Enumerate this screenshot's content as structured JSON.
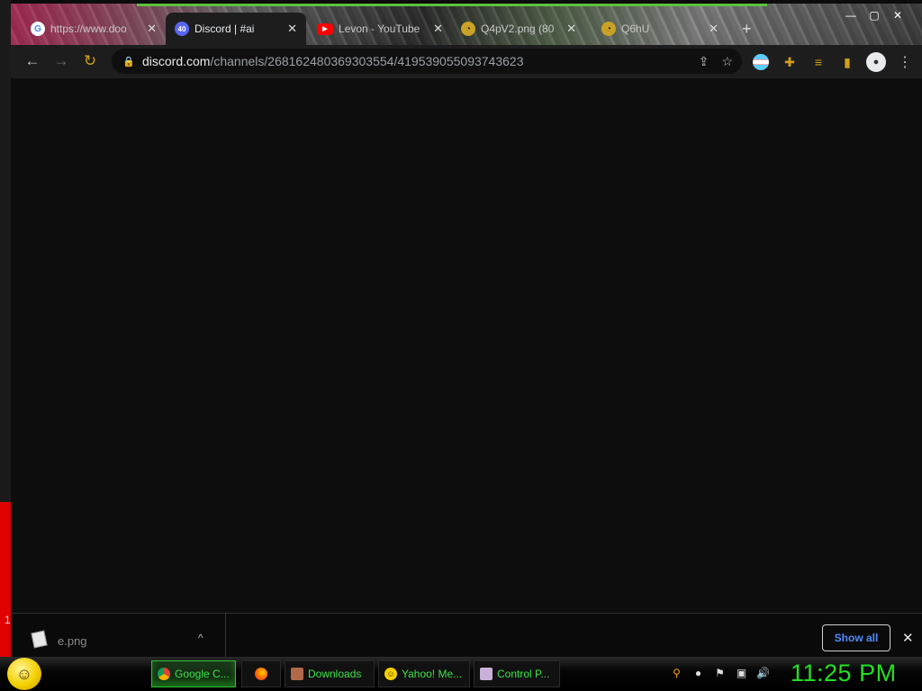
{
  "desktop": {
    "left_marker": "1"
  },
  "tabs": [
    {
      "title": "https://www.doo",
      "favicon": "google-icon",
      "fav_text": "G",
      "close": "✕"
    },
    {
      "title": "Discord | #ai",
      "favicon": "discord-icon",
      "fav_text": "40",
      "close": "✕"
    },
    {
      "title": "Levon - YouTube",
      "favicon": "youtube-icon",
      "fav_text": "▶",
      "close": "✕"
    },
    {
      "title": "Q4pV2.png (80",
      "favicon": "image-icon",
      "fav_text": "◔",
      "close": "✕"
    },
    {
      "title": "Q6hU",
      "favicon": "image-icon",
      "fav_text": "◔",
      "close": "✕"
    }
  ],
  "new_tab": "+",
  "window_controls": {
    "minimize": "—",
    "maximize": "▢",
    "close": "✕"
  },
  "toolbar": {
    "back": "←",
    "forward": "→",
    "reload": "↻",
    "lock": "🔒",
    "url_host": "discord.com",
    "url_path": "/channels/268162480369303554/419539055093743623",
    "share": "⇪",
    "star": "☆",
    "puzzle": "✚",
    "media": "≡",
    "sidepanel": "▮",
    "profile": "●",
    "menu": "⋮"
  },
  "download_shelf": {
    "file_name": "e.png",
    "caret": "^",
    "show_all": "Show all",
    "close": "✕"
  },
  "taskbar": {
    "start": "☺",
    "buttons": [
      {
        "label": "Google C...",
        "icon": "chrome-icon"
      },
      {
        "label": "",
        "icon": "firefox-icon"
      },
      {
        "label": "Downloads",
        "icon": "folder-icon"
      },
      {
        "label": "Yahoo! Me...",
        "icon": "yahoo-icon"
      },
      {
        "label": "Control P...",
        "icon": "control-panel-icon"
      }
    ],
    "tray": {
      "search": "⚲",
      "messenger": "●",
      "flag": "⚑",
      "network": "▣",
      "volume": "🔊"
    },
    "clock": "11:25 PM"
  }
}
